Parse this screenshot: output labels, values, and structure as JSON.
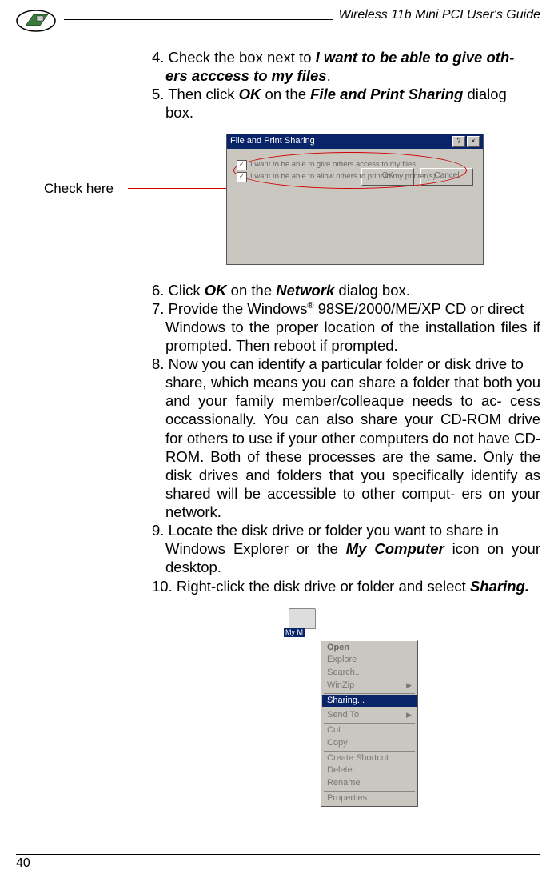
{
  "header": {
    "title": "Wireless 11b Mini PCI  User's Guide"
  },
  "steps": {
    "s4a": "4. Check the box next to ",
    "s4b": "I want to be able to give oth-",
    "s4c": "ers acccess to my files",
    "s4d": ".",
    "s5a": "5. Then click ",
    "s5b": "OK",
    "s5c": " on the ",
    "s5d": "File and Print Sharing",
    "s5e": " dialog",
    "s5f": "box.",
    "s6a": "6. Click ",
    "s6b": "OK",
    "s6c": " on the ",
    "s6d": "Network",
    "s6e": " dialog box.",
    "s7a": "7. Provide the Windows",
    "s7b": "®",
    "s7c": " 98SE/2000/ME/XP CD or direct",
    "s7d": "Windows to the proper location of the installation files if prompted. Then reboot if prompted.",
    "s8a": "8. Now you can identify a particular folder or disk drive to",
    "s8b": "share, which means you can share a folder that both you and your family member/colleaque needs to ac- cess occassionally. You can also share your CD-ROM drive for others to use if your other computers do not have CD-ROM. Both of these processes are the same. Only the disk drives and folders that you specifically identify as shared will be accessible to other comput- ers on  your network.",
    "s9a": "9. Locate the disk drive or folder you want to share in",
    "s9b": "Windows Explorer or the ",
    "s9c": "My Computer",
    "s9d": " icon on your desktop.",
    "s10a": "10. Right-click the disk drive or folder and select ",
    "s10b": "Sharing."
  },
  "annotation": {
    "check_here": "Check  here"
  },
  "dialog": {
    "title": "File and Print Sharing",
    "opt1": "I want to be able to give others access to my files.",
    "opt2": "I want to be able to allow others to print to my printer(s).",
    "ok": "OK",
    "cancel": "Cancel"
  },
  "context_menu": {
    "open": "Open",
    "explore": "Explore",
    "search": "Search...",
    "winzip": "WinZip",
    "sharing": "Sharing...",
    "sendto": "Send To",
    "cut": "Cut",
    "copy": "Copy",
    "shortcut": "Create Shortcut",
    "delete": "Delete",
    "rename": "Rename",
    "properties": "Properties",
    "folder_label": "My M"
  },
  "footer": {
    "page": "40"
  }
}
